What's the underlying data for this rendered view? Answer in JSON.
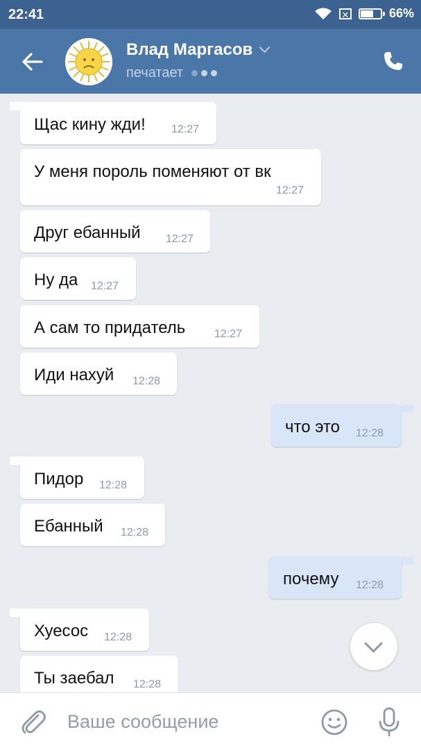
{
  "statusbar": {
    "time": "22:41",
    "battery": "66%",
    "battery_level": 0.66
  },
  "header": {
    "name": "Влад Маргасов",
    "status": "печатает"
  },
  "messages": [
    {
      "text": "Щас кину жди!",
      "time": "12:27",
      "dir": "in"
    },
    {
      "text": "У меня пороль поменяют от вк",
      "time": "12:27",
      "dir": "in"
    },
    {
      "text": "Друг ебанный",
      "time": "12:27",
      "dir": "in"
    },
    {
      "text": "Ну да",
      "time": "12:27",
      "dir": "in"
    },
    {
      "text": "А сам то придатель",
      "time": "12:27",
      "dir": "in"
    },
    {
      "text": "Иди нахуй",
      "time": "12:28",
      "dir": "in"
    },
    {
      "text": "что это",
      "time": "12:28",
      "dir": "out"
    },
    {
      "text": "Пидор",
      "time": "12:28",
      "dir": "in"
    },
    {
      "text": "Ебанный",
      "time": "12:28",
      "dir": "in"
    },
    {
      "text": "почему",
      "time": "12:28",
      "dir": "out"
    },
    {
      "text": "Хуесос",
      "time": "12:28",
      "dir": "in"
    },
    {
      "text": "Ты заебал",
      "time": "12:28",
      "dir": "in"
    }
  ],
  "composer": {
    "placeholder": "Ваше сообщение"
  },
  "icons": {
    "back": "arrow-left-icon",
    "phone": "phone-icon",
    "attach": "paperclip-icon",
    "emoji": "smile-icon",
    "mic": "mic-icon",
    "scroll": "chevron-down-icon"
  },
  "colors": {
    "header": "#4a76a8",
    "statusbar": "#3c6292",
    "outgoing": "#d8e6f7",
    "background": "#e9edf2"
  }
}
